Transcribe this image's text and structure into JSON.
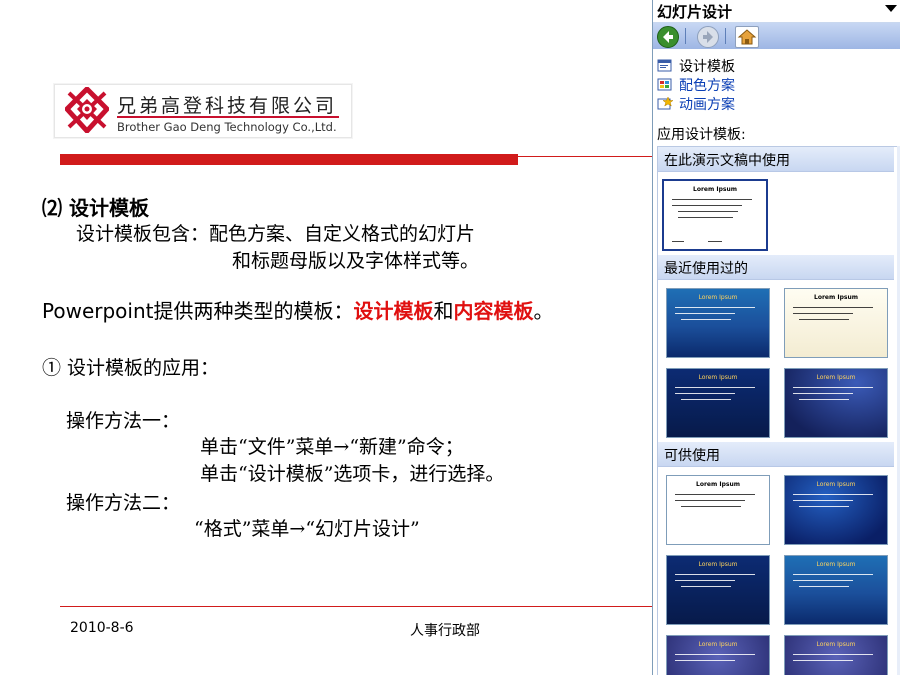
{
  "slide": {
    "logo": {
      "cn": "兄弟高登科技有限公司",
      "en": "Brother Gao Deng Technology Co.,Ltd."
    },
    "heading_num": "⑵",
    "heading": "设计模板",
    "desc_line1": "设计模板包含：配色方案、自定义格式的幻灯片",
    "desc_line2": "和标题母版以及字体样式等。",
    "types_prefix_en": "Powerpoint",
    "types_prefix_cn": "提供两种类型的模板：",
    "types_red1": "设计模板",
    "types_mid": "和",
    "types_red2": "内容模板",
    "types_end": "。",
    "apply_title": "①  设计模板的应用：",
    "method1": "操作方法一：",
    "method1_step1": "单击“文件”菜单→“新建”命令；",
    "method1_step2": "单击“设计模板”选项卡，进行选择。",
    "method2": "操作方法二：",
    "method2_step1": "“格式”菜单→“幻灯片设计”",
    "footer_date": "2010-8-6",
    "footer_dept": "人事行政部"
  },
  "pane": {
    "title": "幻灯片设计",
    "links": [
      "设计模板",
      "配色方案",
      "动画方案"
    ],
    "apply_label": "应用设计模板:",
    "sections": [
      "在此演示文稿中使用",
      "最近使用过的",
      "可供使用"
    ],
    "thumb_title": "Lorem Ipsum"
  }
}
